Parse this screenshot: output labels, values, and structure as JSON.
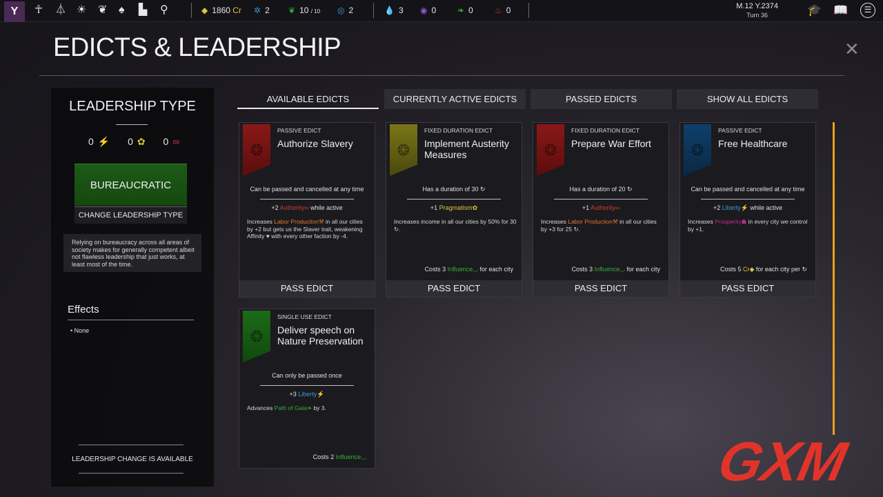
{
  "topbar": {
    "logo": "Y",
    "resources": [
      {
        "value": "1860",
        "unit": "Cr",
        "icon": "diamond-icon"
      },
      {
        "value": "2",
        "icon": "science-icon"
      },
      {
        "value": "10",
        "max": "/ 10",
        "icon": "laurel-icon"
      },
      {
        "value": "2",
        "icon": "swirl-icon"
      },
      {
        "value": "3",
        "icon": "drop-icon"
      },
      {
        "value": "0",
        "icon": "eye-icon"
      },
      {
        "value": "0",
        "icon": "leaf-icon"
      },
      {
        "value": "0",
        "icon": "flame-icon"
      }
    ],
    "date": "M.12 Y.2374",
    "turn": "Turn 36"
  },
  "page_title": "EDICTS & LEADERSHIP",
  "leadership": {
    "title": "LEADERSHIP TYPE",
    "counts": [
      "0",
      "0",
      "0"
    ],
    "type": "BUREAUCRATIC",
    "change_button": "CHANGE LEADERSHIP TYPE",
    "description": "Relying on bureaucracy across all areas of society makes for generally competent albeit not flawless leadership that just works, at least most of the time.",
    "effects_title": "Effects",
    "effects_none": "• None",
    "availability": "LEADERSHIP CHANGE IS AVAILABLE"
  },
  "tabs": [
    "AVAILABLE EDICTS",
    "CURRENTLY ACTIVE EDICTS",
    "PASSED EDICTS",
    "SHOW ALL EDICTS"
  ],
  "cards": [
    {
      "kind": "PASSIVE EDICT",
      "title": "Authorize Slavery",
      "condition": "Can be passed and cancelled at any time",
      "line_pre": "+2 ",
      "line_hl": "Authority",
      "line_post": " while active",
      "effect_pre": "Increases ",
      "effect_hl": "Labor Production",
      "effect_post": " in all our cities by +2 but gets us the Slaver trait, weakening Affinity ♥ with every other faction by -4.",
      "cost_pre": "",
      "cost_hl": "",
      "cost_post": "",
      "button": "PASS EDICT"
    },
    {
      "kind": "FIXED DURATION EDICT",
      "title": "Implement Austerity Measures",
      "condition": "Has a duration of 30 ↻",
      "line_pre": "+1 ",
      "line_hl": "Pragmatism",
      "line_post": "",
      "effect_pre": "",
      "effect_hl": "",
      "effect_post": "Increases income in all our cities by 50% for 30 ↻.",
      "cost_pre": "Costs 3 ",
      "cost_hl": "Influence",
      "cost_post": " for each city",
      "button": "PASS EDICT"
    },
    {
      "kind": "FIXED DURATION EDICT",
      "title": "Prepare War Effort",
      "condition": "Has a duration of 20 ↻",
      "line_pre": "+1 ",
      "line_hl": "Authority",
      "line_post": "",
      "effect_pre": "Increases ",
      "effect_hl": "Labor Production",
      "effect_post": " in all our cities by +3 for 25 ↻.",
      "cost_pre": "Costs 3 ",
      "cost_hl": "Influence",
      "cost_post": " for each city",
      "button": "PASS EDICT"
    },
    {
      "kind": "PASSIVE EDICT",
      "title": "Free Healthcare",
      "condition": "Can be passed and cancelled at any time",
      "line_pre": "+2 ",
      "line_hl": "Liberty",
      "line_post": " while active",
      "effect_pre": "Increases ",
      "effect_hl": "Prosperity",
      "effect_post": " in every city we control by +1.",
      "cost_pre": "Costs 5 ",
      "cost_hl": "Cr",
      "cost_post": " for each city per ↻",
      "button": "PASS EDICT"
    },
    {
      "kind": "SINGLE USE EDICT",
      "title": "Deliver speech on Nature Preservation",
      "condition": "Can only be passed once",
      "line_pre": "+3 ",
      "line_hl": "Liberty",
      "line_post": "",
      "effect_pre": "Advances ",
      "effect_hl": "Path of Gaia",
      "effect_post": " by 3.",
      "cost_pre": "Costs 2 ",
      "cost_hl": "Influence",
      "cost_post": "",
      "button": ""
    }
  ],
  "watermark": "GXM"
}
